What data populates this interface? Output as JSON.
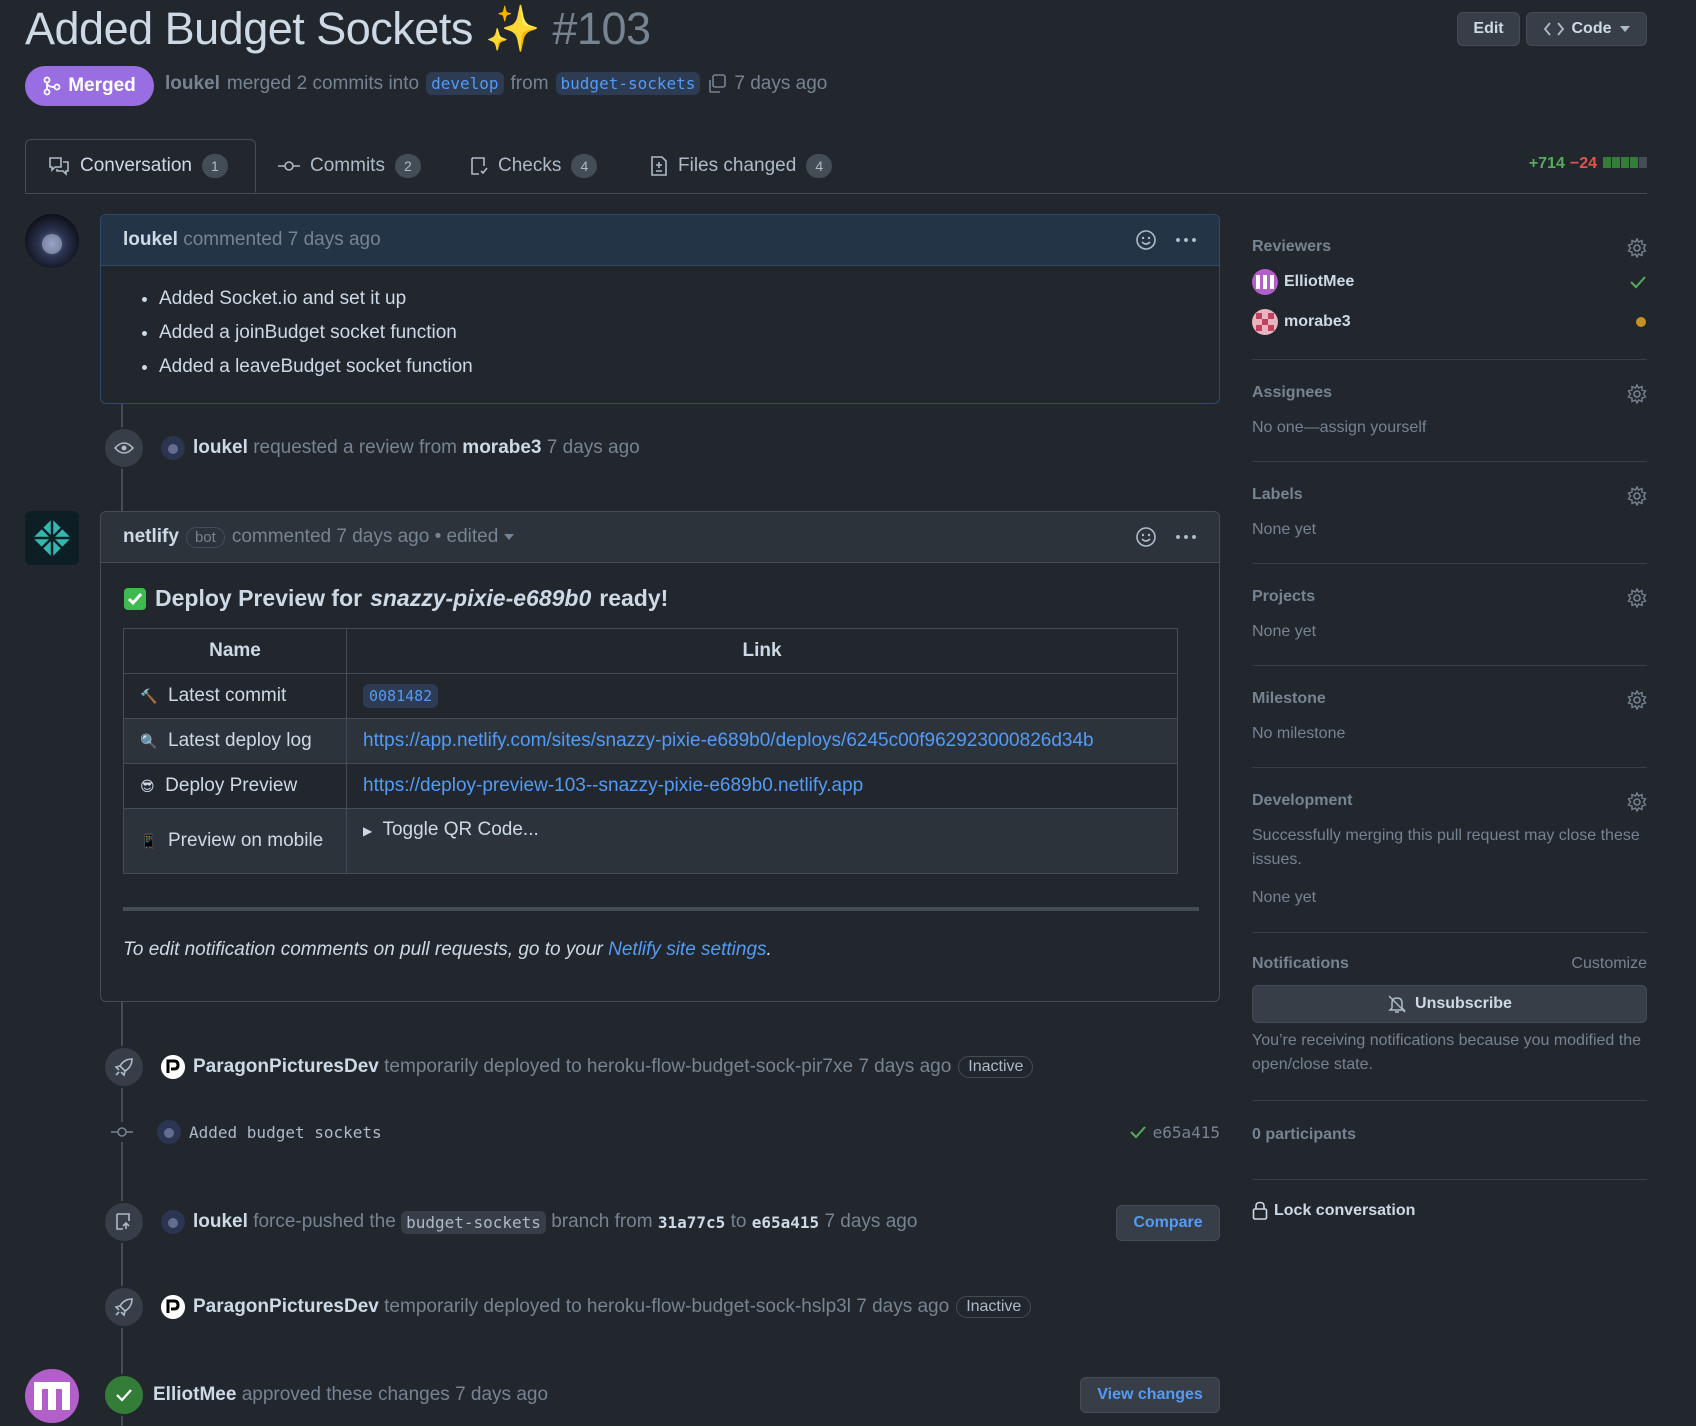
{
  "header": {
    "title": "Added Budget Sockets",
    "title_emoji": "✨",
    "number": "#103",
    "edit_label": "Edit",
    "code_label": "Code",
    "state": "Merged",
    "author": "loukel",
    "merge_text": "merged 2 commits into",
    "base_branch": "develop",
    "from_text": "from",
    "head_branch": "budget-sockets",
    "time": "7 days ago"
  },
  "tabs": [
    {
      "label": "Conversation",
      "count": "1"
    },
    {
      "label": "Commits",
      "count": "2"
    },
    {
      "label": "Checks",
      "count": "4"
    },
    {
      "label": "Files changed",
      "count": "4"
    }
  ],
  "diffstat": {
    "additions": "+714",
    "deletions": "−24"
  },
  "comment1": {
    "author": "loukel",
    "meta": "commented 7 days ago",
    "items": [
      "Added Socket.io and set it up",
      "Added a joinBudget socket function",
      "Added a leaveBudget socket function"
    ]
  },
  "review_request": {
    "actor": "loukel",
    "text": "requested a review from",
    "reviewer": "morabe3",
    "time": "7 days ago"
  },
  "comment2": {
    "author": "netlify",
    "bot_label": "bot",
    "meta": "commented 7 days ago",
    "edited": "• edited",
    "heading_prefix": "Deploy Preview for",
    "heading_site": "snazzy-pixie-e689b0",
    "heading_suffix": "ready!",
    "table_headers": [
      "Name",
      "Link"
    ],
    "rows": [
      {
        "emoji": "🔨",
        "name": "Latest commit",
        "value": "0081482"
      },
      {
        "emoji": "🔍",
        "name": "Latest deploy log",
        "value": "https://app.netlify.com/sites/snazzy-pixie-e689b0/deploys/6245c00f962923000826d34b"
      },
      {
        "emoji": "😎",
        "name": "Deploy Preview",
        "value": "https://deploy-preview-103--snazzy-pixie-e689b0.netlify.app"
      },
      {
        "emoji": "📱",
        "name": "Preview on mobile",
        "value": "Toggle QR Code..."
      }
    ],
    "note_prefix": "To edit notification comments on pull requests, go to your",
    "note_link": "Netlify site settings",
    "note_suffix": "."
  },
  "deploy1": {
    "actor": "ParagonPicturesDev",
    "text": "temporarily deployed to heroku-flow-budget-sock-pir7xe",
    "time": "7 days ago",
    "badge": "Inactive"
  },
  "commit": {
    "message": "Added budget sockets",
    "sha": "e65a415"
  },
  "force_push": {
    "actor": "loukel",
    "text1": "force-pushed the",
    "branch": "budget-sockets",
    "text2": "branch from",
    "from_sha": "31a77c5",
    "to_text": "to",
    "to_sha": "e65a415",
    "time": "7 days ago",
    "button": "Compare"
  },
  "deploy2": {
    "actor": "ParagonPicturesDev",
    "text": "temporarily deployed to heroku-flow-budget-sock-hslp3l",
    "time": "7 days ago",
    "badge": "Inactive"
  },
  "approval": {
    "actor": "ElliotMee",
    "text": "approved these changes",
    "time": "7 days ago",
    "button": "View changes"
  },
  "sidebar": {
    "reviewers_title": "Reviewers",
    "reviewers": [
      {
        "name": "ElliotMee",
        "status": "approved"
      },
      {
        "name": "morabe3",
        "status": "pending"
      }
    ],
    "assignees_title": "Assignees",
    "assignees_value": "No one—assign yourself",
    "labels_title": "Labels",
    "labels_value": "None yet",
    "projects_title": "Projects",
    "projects_value": "None yet",
    "milestone_title": "Milestone",
    "milestone_value": "No milestone",
    "development_title": "Development",
    "development_desc": "Successfully merging this pull request may close these issues.",
    "development_value": "None yet",
    "notifications_title": "Notifications",
    "customize": "Customize",
    "unsubscribe": "Unsubscribe",
    "notifications_reason": "You’re receiving notifications because you modified the open/close state.",
    "participants": "0 participants",
    "lock": "Lock conversation"
  },
  "colors": {
    "background": "#22272e",
    "merged": "#986ee2",
    "link": "#539bf5",
    "success": "#57ab5a",
    "danger": "#e5534b",
    "pending": "#c69026"
  }
}
